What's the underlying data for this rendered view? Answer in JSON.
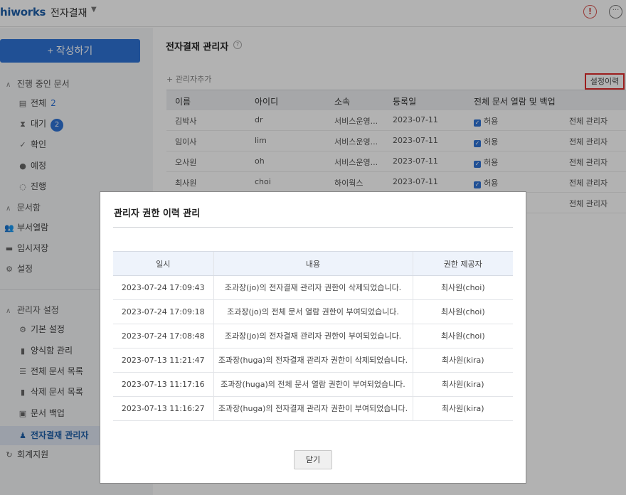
{
  "header": {
    "brand": "hiworks",
    "app_title": "전자결재",
    "caret": "▼",
    "alert_icon": "!",
    "more_icon": "···"
  },
  "sidebar": {
    "write_button": "+ 작성하기",
    "in_progress_section": "진행 중인 문서",
    "in_progress_items": [
      {
        "label": "전체",
        "count": "2",
        "icon": "file-icon"
      },
      {
        "label": "대기",
        "count": "2",
        "icon": "hourglass-icon"
      },
      {
        "label": "확인",
        "icon": "check-icon"
      },
      {
        "label": "예정",
        "icon": "clock-icon"
      },
      {
        "label": "진행",
        "icon": "spinner-icon"
      }
    ],
    "archive_section": "문서함",
    "archive_items": [
      {
        "label": "부서열람",
        "icon": "people-icon"
      },
      {
        "label": "임시저장",
        "icon": "folder-icon"
      },
      {
        "label": "설정",
        "icon": "gear-icon"
      }
    ],
    "admin_section": "관리자 설정",
    "admin_items": [
      {
        "label": "기본 설정",
        "icon": "gear-icon"
      },
      {
        "label": "양식함 관리",
        "icon": "file-icon"
      },
      {
        "label": "전체 문서 목록",
        "icon": "list-icon"
      },
      {
        "label": "삭제 문서 목록",
        "icon": "trash-icon"
      },
      {
        "label": "문서 백업",
        "icon": "backup-icon"
      },
      {
        "label": "전자결재 관리자",
        "icon": "admin-icon"
      }
    ],
    "accounting": "회계지원"
  },
  "main": {
    "title": "전자결재 관리자",
    "add_admin": "+ 관리자추가",
    "history_button": "설정이력",
    "columns": [
      "이름",
      "아이디",
      "소속",
      "등록일",
      "전체 문서 열람 및 백업"
    ],
    "rows": [
      {
        "name": "김박사",
        "id": "dr",
        "dept": "서비스운영...",
        "date": "2023-07-11",
        "perm": "허용",
        "role": "전체 관리자"
      },
      {
        "name": "임이사",
        "id": "lim",
        "dept": "서비스운영...",
        "date": "2023-07-11",
        "perm": "허용",
        "role": "전체 관리자"
      },
      {
        "name": "오사원",
        "id": "oh",
        "dept": "서비스운영...",
        "date": "2023-07-11",
        "perm": "허용",
        "role": "전체 관리자"
      },
      {
        "name": "최사원",
        "id": "choi",
        "dept": "하이웍스",
        "date": "2023-07-11",
        "perm": "허용",
        "role": "전체 관리자"
      }
    ],
    "extra_role": "전체 관리자"
  },
  "modal": {
    "title": "관리자 권한 이력 관리",
    "columns": [
      "일시",
      "내용",
      "권한 제공자"
    ],
    "rows": [
      {
        "time": "2023-07-24 17:09:43",
        "content": "조과장(jo)의 전자결재 관리자 권한이 삭제되었습니다.",
        "provider": "최사원(choi)"
      },
      {
        "time": "2023-07-24 17:09:18",
        "content": "조과장(jo)의 전체 문서 열람 권한이 부여되었습니다.",
        "provider": "최사원(choi)"
      },
      {
        "time": "2023-07-24 17:08:48",
        "content": "조과장(jo)의 전자결재 관리자 권한이 부여되었습니다.",
        "provider": "최사원(choi)"
      },
      {
        "time": "2023-07-13 11:21:47",
        "content": "조과장(huga)의 전자결재 관리자 권한이 삭제되었습니다.",
        "provider": "최사원(kira)"
      },
      {
        "time": "2023-07-13 11:17:16",
        "content": "조과장(huga)의 전체 문서 열람 권한이 부여되었습니다.",
        "provider": "최사원(kira)"
      },
      {
        "time": "2023-07-13 11:16:27",
        "content": "조과장(huga)의 전자결재 관리자 권한이 부여되었습니다.",
        "provider": "최사원(kira)"
      }
    ],
    "close_button": "닫기"
  },
  "colors": {
    "accent": "#2f73d6",
    "highlight_border": "#e02b2b",
    "alert": "#d9534f"
  }
}
